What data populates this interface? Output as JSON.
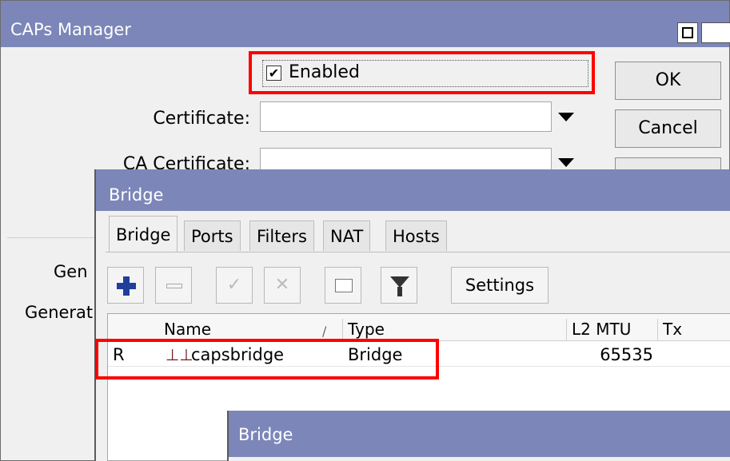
{
  "caps": {
    "title": "CAPs Manager",
    "enabled_label": "Enabled",
    "enabled_checked": true,
    "certificate_label": "Certificate:",
    "certificate_value": "",
    "ca_certificate_label": "CA Certificate:",
    "ok_label": "OK",
    "cancel_label": "Cancel",
    "generate_label_1": "Gen",
    "generate_label_2": "Generat"
  },
  "bridge_window": {
    "title": "Bridge",
    "tabs": [
      {
        "label": "Bridge",
        "active": true
      },
      {
        "label": "Ports",
        "active": false
      },
      {
        "label": "Filters",
        "active": false
      },
      {
        "label": "NAT",
        "active": false
      },
      {
        "label": "Hosts",
        "active": false
      }
    ],
    "toolbar": {
      "settings_label": "Settings"
    },
    "table": {
      "columns": [
        "",
        "Name",
        "Type",
        "L2 MTU",
        "Tx"
      ],
      "rows": [
        {
          "flag": "R",
          "name": "capsbridge",
          "type": "Bridge",
          "l2mtu": "65535",
          "tx": ""
        }
      ]
    }
  },
  "bridge_dialog": {
    "title": "Bridge"
  },
  "colors": {
    "titlebar": "#7c86b8",
    "highlight": "#ff0000",
    "add_icon": "#1f3f9a"
  }
}
